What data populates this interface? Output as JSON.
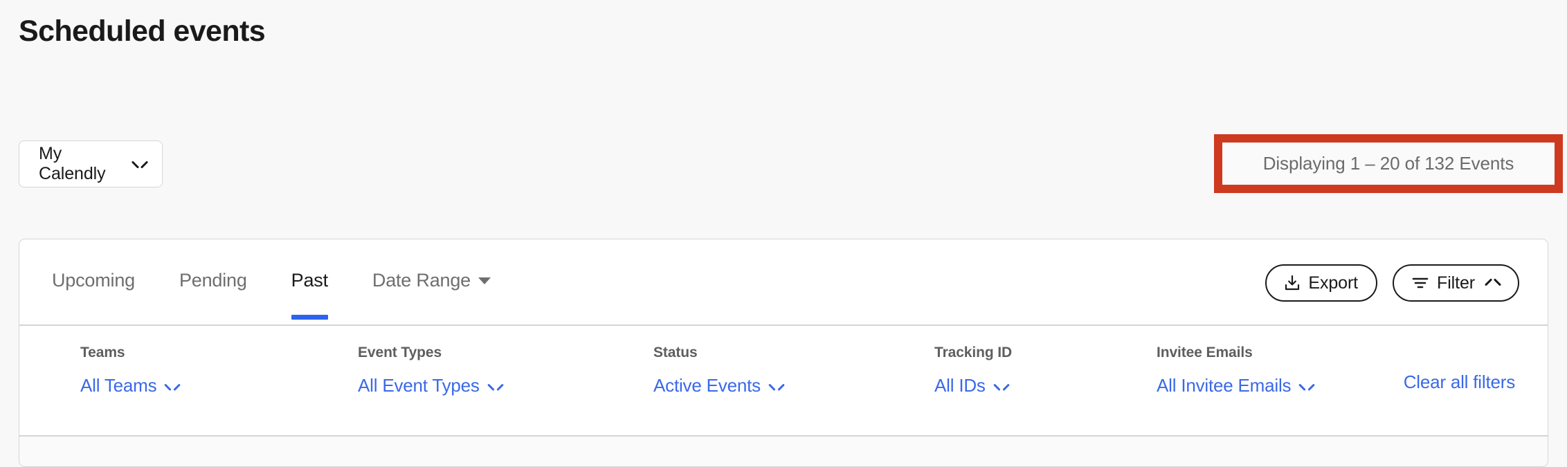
{
  "page": {
    "title": "Scheduled events",
    "background_color": "#f8f8f8"
  },
  "toolbar": {
    "owner_select": {
      "label": "My Calendly",
      "icon": "chevron-down-icon"
    },
    "pagination": {
      "text": "Displaying 1 – 20 of 132 Events",
      "highlight_color": "#cd3a20",
      "highlighted": true
    }
  },
  "card": {
    "tabs": [
      {
        "label": "Upcoming",
        "active": false,
        "has_caret": false
      },
      {
        "label": "Pending",
        "active": false,
        "has_caret": false
      },
      {
        "label": "Past",
        "active": true,
        "has_caret": false
      },
      {
        "label": "Date Range",
        "active": false,
        "has_caret": true
      }
    ],
    "active_tab_indicator_color": "#2c63ef",
    "actions": {
      "export": {
        "label": "Export",
        "icon": "download-icon"
      },
      "filter": {
        "label": "Filter",
        "icon": "filter-icon",
        "chevron": "chevron-up-icon",
        "expanded": true
      }
    },
    "filters": [
      {
        "label": "Teams",
        "value": "All Teams",
        "icon": "chevron-down-icon"
      },
      {
        "label": "Event Types",
        "value": "All Event Types",
        "icon": "chevron-down-icon"
      },
      {
        "label": "Status",
        "value": "Active Events",
        "icon": "chevron-down-icon"
      },
      {
        "label": "Tracking ID",
        "value": "All IDs",
        "icon": "chevron-down-icon"
      },
      {
        "label": "Invitee Emails",
        "value": "All Invitee Emails",
        "icon": "chevron-down-icon"
      }
    ],
    "clear_filters_label": "Clear all filters",
    "link_color": "#3a69e8"
  }
}
